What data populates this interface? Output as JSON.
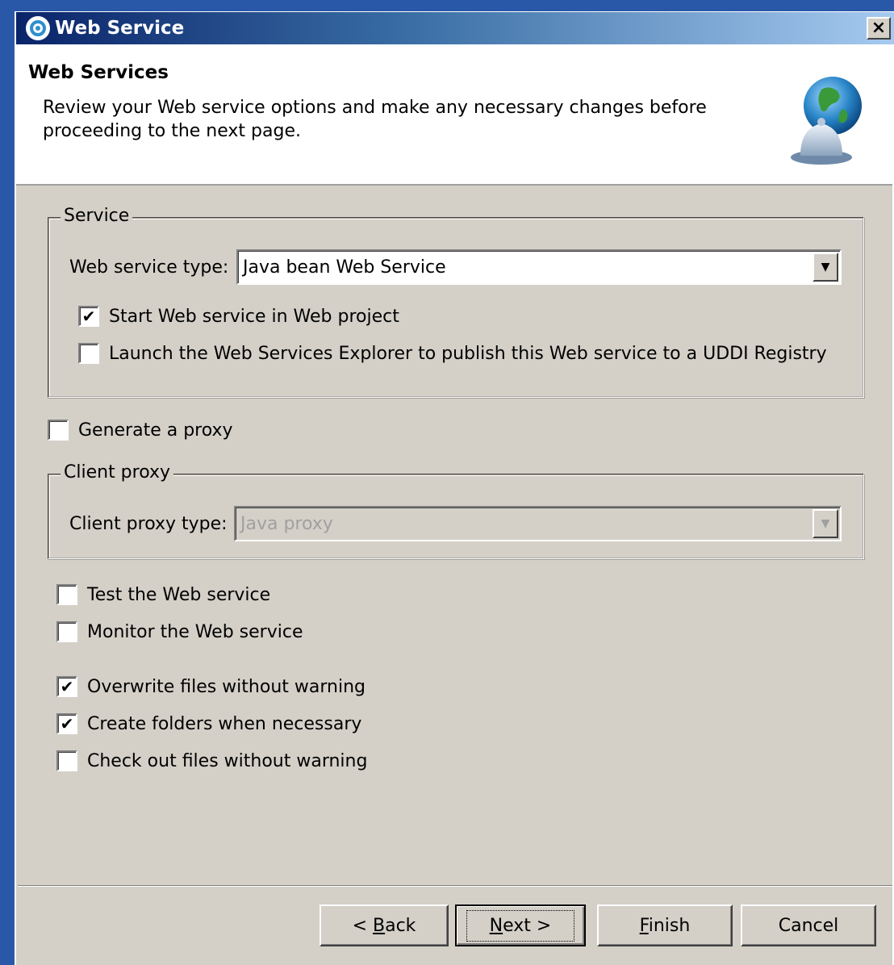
{
  "window": {
    "title": "Web Service",
    "close_label": "×"
  },
  "header": {
    "title": "Web Services",
    "description": "Review your Web service options and make any necessary changes before proceeding to the next page."
  },
  "service_group": {
    "legend": "Service",
    "type_label": "Web service type:",
    "type_value": "Java bean Web Service",
    "start_service": {
      "label": "Start Web service in Web project",
      "checked": true
    },
    "launch_explorer": {
      "label": "Launch the Web Services Explorer to publish this Web service to a UDDI Registry",
      "checked": false
    }
  },
  "generate_proxy": {
    "label": "Generate a proxy",
    "checked": false
  },
  "client_proxy_group": {
    "legend": "Client proxy",
    "type_label": "Client proxy type:",
    "type_value": "Java proxy",
    "enabled": false
  },
  "options": {
    "test_service": {
      "label": "Test the Web service",
      "checked": false
    },
    "monitor_service": {
      "label": "Monitor the Web service",
      "checked": false
    },
    "overwrite_files": {
      "label": "Overwrite files without warning",
      "checked": true
    },
    "create_folders": {
      "label": "Create folders when necessary",
      "checked": true
    },
    "checkout_files": {
      "label": "Check out files without warning",
      "checked": false
    }
  },
  "buttons": {
    "back_prefix": "< ",
    "back_key": "B",
    "back_rest": "ack",
    "next_key": "N",
    "next_rest": "ext >",
    "finish_key": "F",
    "finish_rest": "inish",
    "cancel": "Cancel"
  },
  "icons": {
    "app": "web-service-swirl-icon",
    "banner": "globe-bell-icon",
    "check": "✔",
    "dropdown": "▼"
  },
  "colors": {
    "titlebar_start": "#0a246a",
    "titlebar_end": "#a6caf0",
    "dialog_bg": "#d4d0c8",
    "desktop_bg": "#2a58a8"
  }
}
